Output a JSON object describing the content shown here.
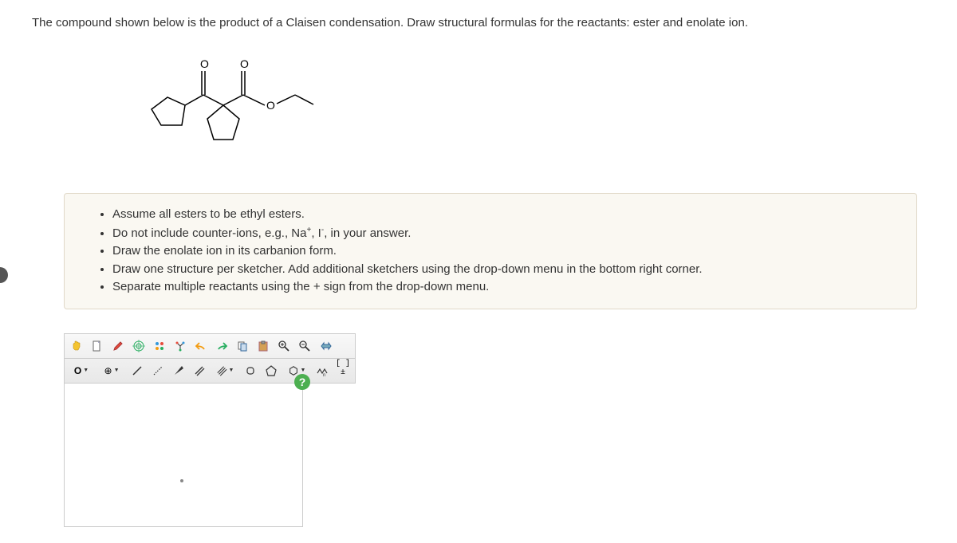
{
  "question": "The compound shown below is the product of a Claisen condensation. Draw structural formulas for the reactants: ester and enolate ion.",
  "instructions": [
    "Assume all esters to be ethyl esters.",
    "Do not include counter-ions, e.g., Na⁺, I⁻, in your answer.",
    "Draw the enolate ion in its carbbanion form.",
    "Draw one structure per sketcher. Add additional sketchers using the drop-down menu in the bottom right corner.",
    "Separate multiple reactants using the + sign from the drop-down menu."
  ],
  "instructions_html": [
    "Assume all esters to be ethyl esters.",
    "Do not include counter-ions, e.g., Na<sup>+</sup>, I<sup>-</sup>, in your answer.",
    "Draw the enolate ion in its carbanion form.",
    "Draw one structure per sketcher. Add additional sketchers using the drop-down menu in the bottom right corner.",
    "Separate multiple reactants using the + sign from the drop-down menu."
  ],
  "toolbar": {
    "row1": [
      "hand",
      "file",
      "draw",
      "target",
      "view-cross",
      "view-ball",
      "undo",
      "redo",
      "copy",
      "paste",
      "zoom-in",
      "zoom-out",
      "transform"
    ],
    "row2_labels": {
      "element": "O",
      "charge": "⊕"
    }
  },
  "help_label": "?"
}
